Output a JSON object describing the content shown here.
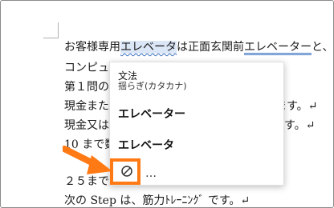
{
  "document": {
    "lines": [
      {
        "pre": "お客様専用",
        "hl": "エレベータ",
        "mid": "は正面玄関前",
        "sugg": "エレベーター",
        "post": "と、"
      },
      {
        "text": "コンピュ"
      },
      {
        "text": "第１問の"
      },
      {
        "left": "現金また",
        "right": "ります。↵"
      },
      {
        "left": "現金又は",
        "right": "ます。↵"
      },
      {
        "text": "10 まで数"
      },
      {
        "text": "２５まで"
      },
      {
        "text": "次の Step は、筋力ﾄﾚｰﾆﾝｸﾞ です。↵"
      }
    ]
  },
  "popup": {
    "category": "文法",
    "subcategory": "揺らぎ(カタカナ)",
    "option1": "エレベーター",
    "option2": "エレベータ",
    "ignore_icon": "ignore-icon",
    "more_icon": "more-options-icon",
    "more_text": "…"
  },
  "colors": {
    "highlight": "#dbe6f6",
    "accent": "#ff7a14",
    "underline": "#3a6fbf"
  }
}
